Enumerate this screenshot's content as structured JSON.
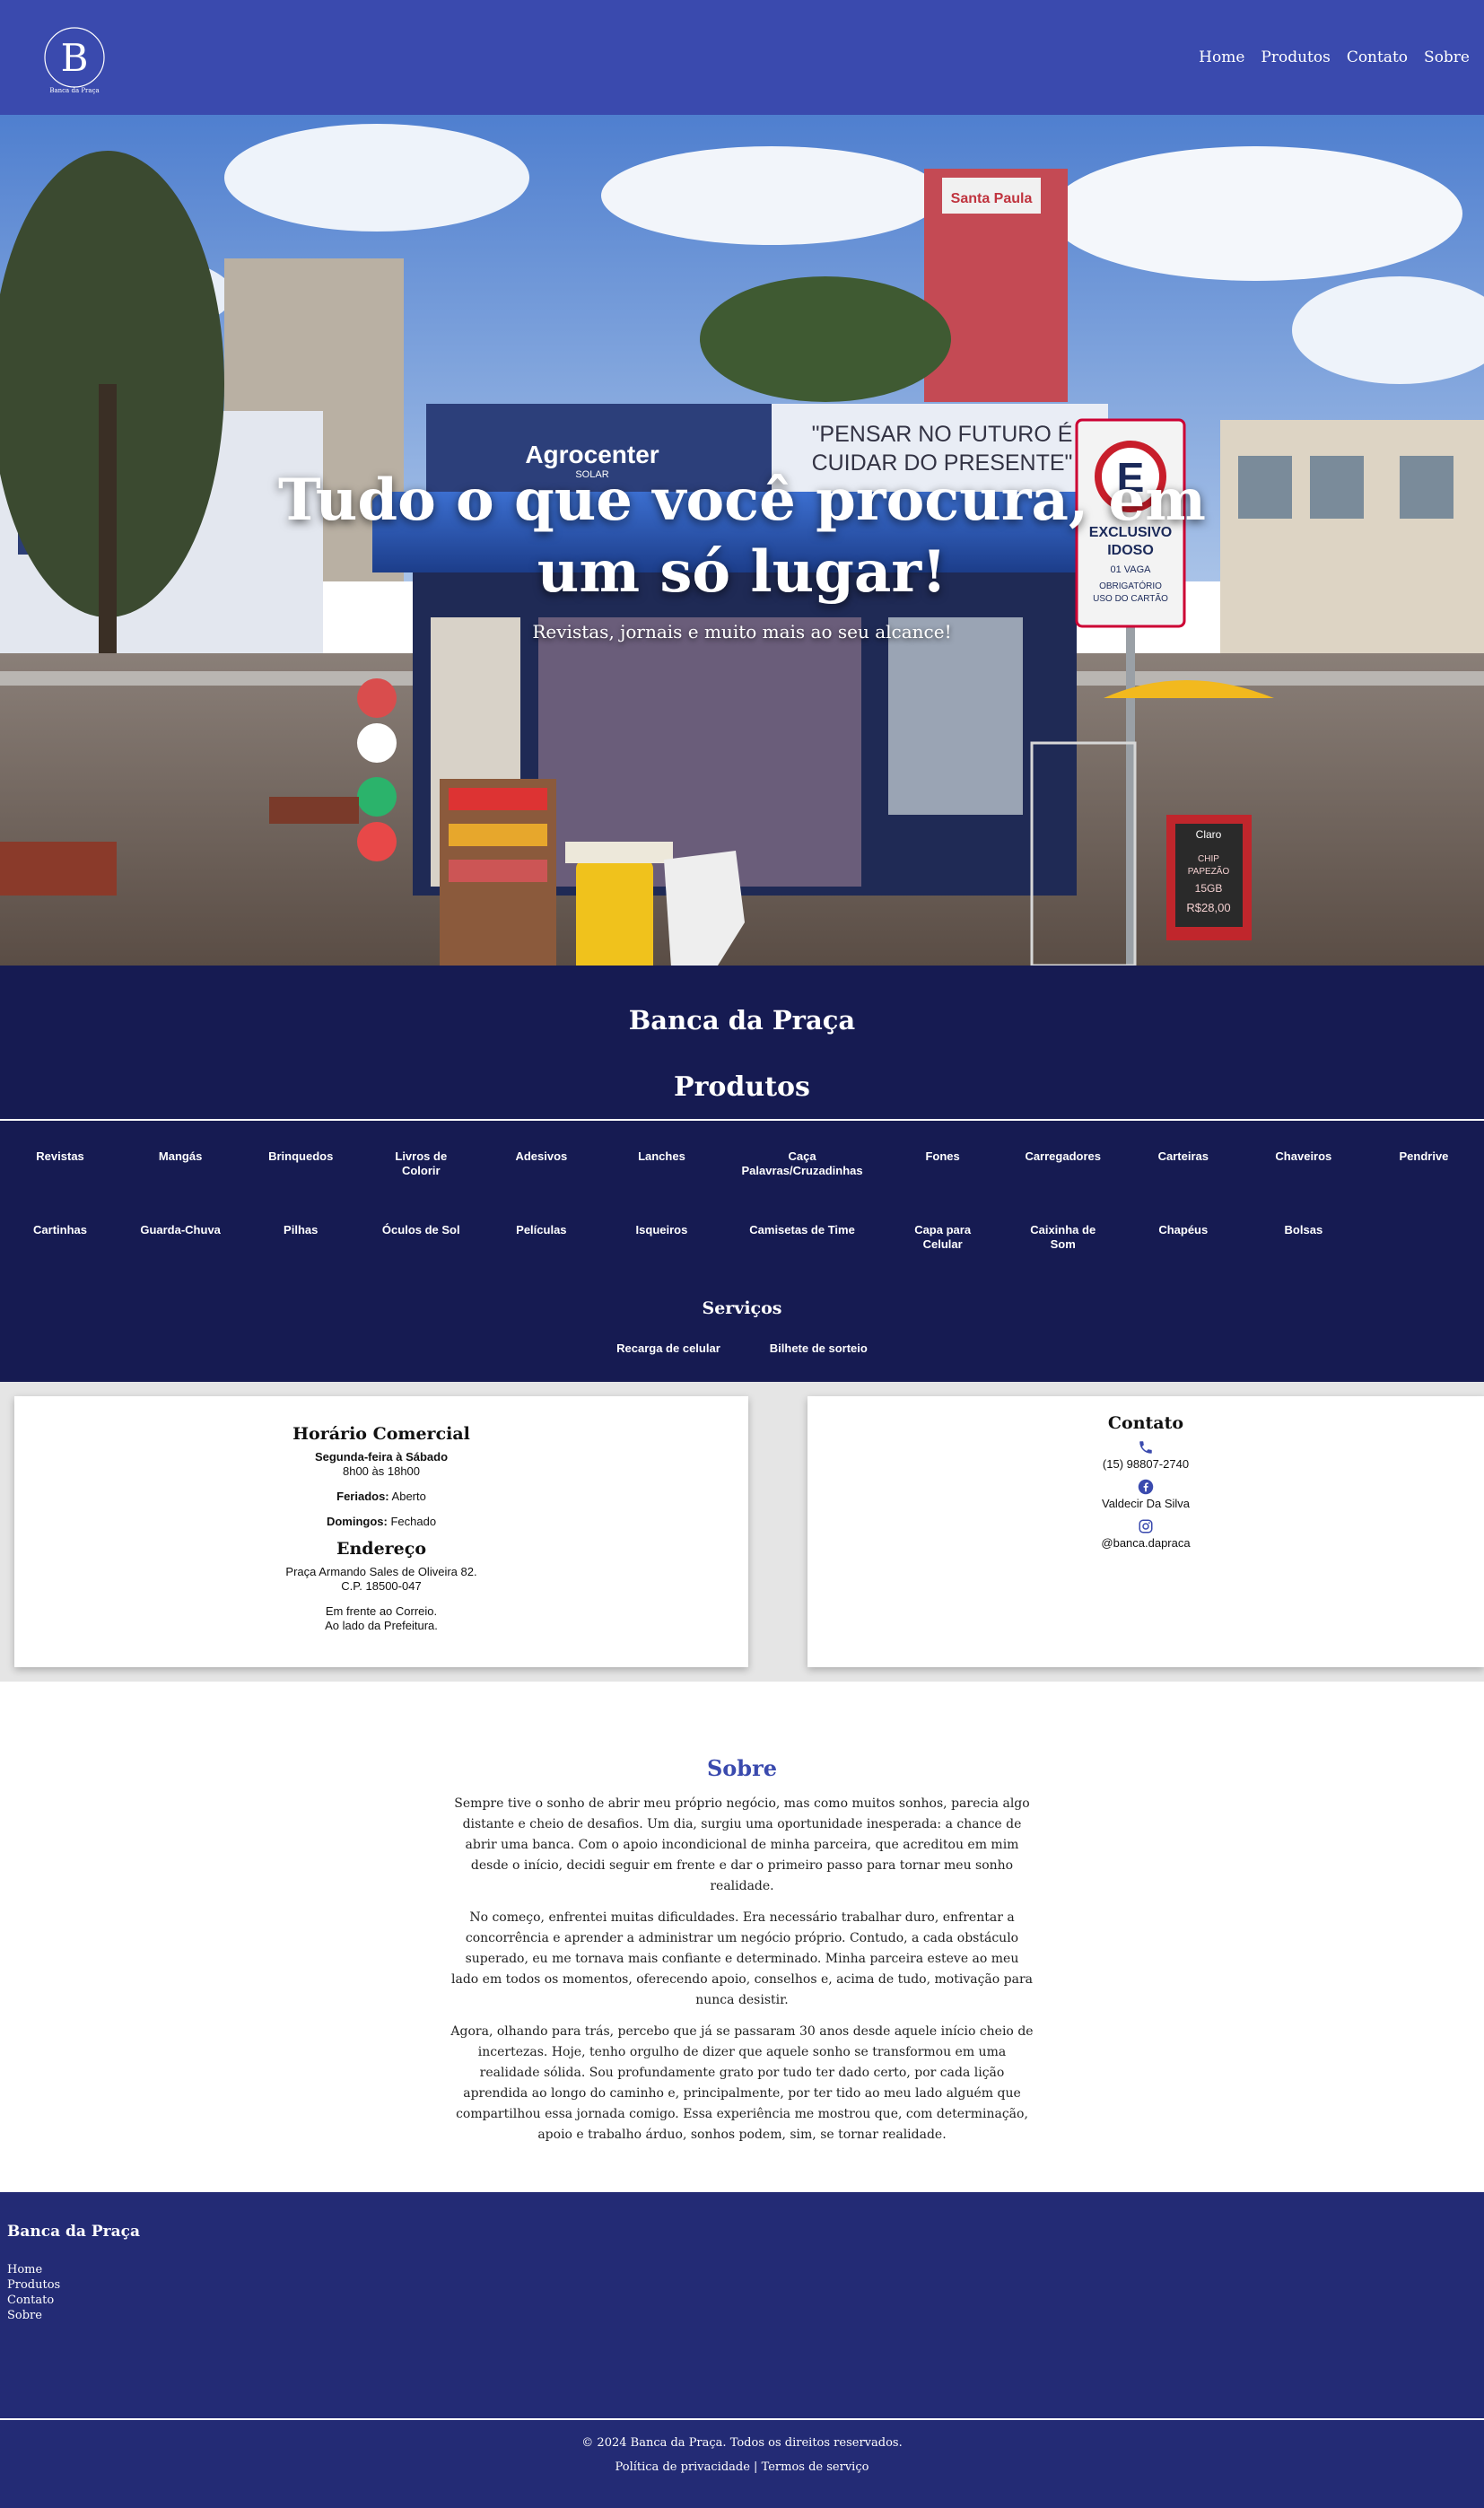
{
  "header": {
    "logo_letter": "B",
    "logo_caption": "Banca da Praça",
    "nav": [
      "Home",
      "Produtos",
      "Contato",
      "Sobre"
    ]
  },
  "hero": {
    "title": "Tudo o que você procura, em um só lugar!",
    "subtitle": "Revistas, jornais e muito mais ao seu alcance!",
    "photo_signs": {
      "banner_brand": "Agrocenter",
      "banner_brand_sub": "SOLAR",
      "banner_slogan_1": "\"PENSAR NO FUTURO É",
      "banner_slogan_2": "CUIDAR DO PRESENTE\"",
      "parking_letter": "E",
      "parking_1": "EXCLUSIVO",
      "parking_2": "IDOSO",
      "parking_3": "01 VAGA",
      "parking_4": "OBRIGATÓRIO",
      "parking_5": "USO DO CARTÃO",
      "store_sign": "Santa Paula",
      "chalk_brand": "Claro",
      "chalk_1": "CHIP",
      "chalk_2": "PAPEZÃO",
      "chalk_3": "15GB",
      "chalk_4": "R$28,00"
    }
  },
  "products": {
    "brand": "Banca da Praça",
    "title": "Produtos",
    "items": [
      "Revistas",
      "Mangás",
      "Brinquedos",
      "Livros de Colorir",
      "Adesivos",
      "Lanches",
      "Caça Palavras/Cruzadinhas",
      "Fones",
      "Carregadores",
      "Carteiras",
      "Chaveiros",
      "Pendrive",
      "Cartinhas",
      "Guarda-Chuva",
      "Pilhas",
      "Óculos de Sol",
      "Películas",
      "Isqueiros",
      "Camisetas de Time",
      "Capa para Celular",
      "Caixinha de Som",
      "Chapéus",
      "Bolsas"
    ],
    "services_title": "Serviços",
    "services": [
      "Recarga de celular",
      "Bilhete de sorteio"
    ]
  },
  "hours": {
    "title": "Horário Comercial",
    "weekdays_label": "Segunda-feira à Sábado",
    "weekdays_value": "8h00 às 18h00",
    "holidays_label": "Feriados:",
    "holidays_value": "Aberto",
    "sundays_label": "Domingos:",
    "sundays_value": "Fechado",
    "address_title": "Endereço",
    "address_line1": "Praça Armando Sales de Oliveira 82.",
    "address_line2": "C.P. 18500-047",
    "ref_line1": "Em frente ao Correio.",
    "ref_line2": "Ao lado da Prefeitura."
  },
  "contact": {
    "title": "Contato",
    "phone": "(15) 98807-2740",
    "facebook": "Valdecir Da Silva",
    "instagram": "@banca.dapraca",
    "accent": "#3a4aae"
  },
  "about": {
    "title": "Sobre",
    "paragraphs": [
      "Sempre tive o sonho de abrir meu próprio negócio, mas como muitos sonhos, parecia algo distante e cheio de desafios. Um dia, surgiu uma oportunidade inesperada: a chance de abrir uma banca. Com o apoio incondicional de minha parceira, que acreditou em mim desde o início, decidi seguir em frente e dar o primeiro passo para tornar meu sonho realidade.",
      "No começo, enfrentei muitas dificuldades. Era necessário trabalhar duro, enfrentar a concorrência e aprender a administrar um negócio próprio. Contudo, a cada obstáculo superado, eu me tornava mais confiante e determinado. Minha parceira esteve ao meu lado em todos os momentos, oferecendo apoio, conselhos e, acima de tudo, motivação para nunca desistir.",
      "Agora, olhando para trás, percebo que já se passaram 30 anos desde aquele início cheio de incertezas. Hoje, tenho orgulho de dizer que aquele sonho se transformou em uma realidade sólida. Sou profundamente grato por tudo ter dado certo, por cada lição aprendida ao longo do caminho e, principalmente, por ter tido ao meu lado alguém que compartilhou essa jornada comigo. Essa experiência me mostrou que, com determinação, apoio e trabalho árduo, sonhos podem, sim, se tornar realidade."
    ]
  },
  "footer": {
    "brand": "Banca da Praça",
    "links": [
      "Home",
      "Produtos",
      "Contato",
      "Sobre"
    ],
    "copyright": "© 2024 Banca da Praça. Todos os direitos reservados.",
    "privacy": "Política de privacidade",
    "separator": "|",
    "terms": "Termos de serviço"
  },
  "colors": {
    "header": "#3a4aae",
    "products_bg": "#161b52",
    "footer_bg": "#232b75"
  }
}
